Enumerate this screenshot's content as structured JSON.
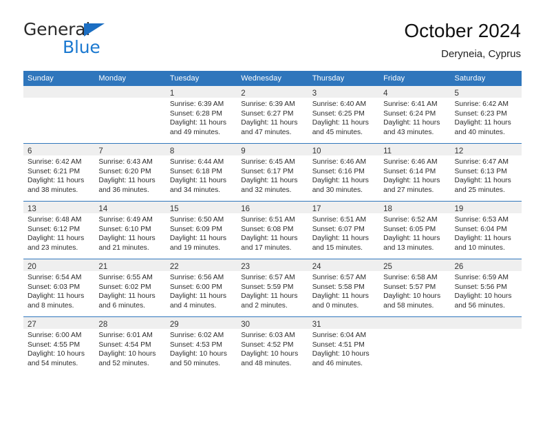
{
  "brand": {
    "word_one": "General",
    "word_two": "Blue",
    "triangle_icon": "triangle-logo-icon",
    "colors": {
      "dark": "#2b2b2b",
      "blue": "#1b79d0"
    }
  },
  "header": {
    "title": "October 2024",
    "subtitle": "Deryneia, Cyprus"
  },
  "theme": {
    "header_blue": "#2f76bc",
    "daynum_band": "#efefef",
    "text": "#2b2b2b"
  },
  "weekday_headers": [
    "Sunday",
    "Monday",
    "Tuesday",
    "Wednesday",
    "Thursday",
    "Friday",
    "Saturday"
  ],
  "labels": {
    "sunrise_prefix": "Sunrise:",
    "sunset_prefix": "Sunset:",
    "daylight_prefix": "Daylight:"
  },
  "weeks": [
    [
      {
        "day": "",
        "empty": true
      },
      {
        "day": "",
        "empty": true
      },
      {
        "day": "1",
        "line1": "Sunrise: 6:39 AM",
        "line2": "Sunset: 6:28 PM",
        "line3": "Daylight: 11 hours",
        "line4": "and 49 minutes."
      },
      {
        "day": "2",
        "line1": "Sunrise: 6:39 AM",
        "line2": "Sunset: 6:27 PM",
        "line3": "Daylight: 11 hours",
        "line4": "and 47 minutes."
      },
      {
        "day": "3",
        "line1": "Sunrise: 6:40 AM",
        "line2": "Sunset: 6:25 PM",
        "line3": "Daylight: 11 hours",
        "line4": "and 45 minutes."
      },
      {
        "day": "4",
        "line1": "Sunrise: 6:41 AM",
        "line2": "Sunset: 6:24 PM",
        "line3": "Daylight: 11 hours",
        "line4": "and 43 minutes."
      },
      {
        "day": "5",
        "line1": "Sunrise: 6:42 AM",
        "line2": "Sunset: 6:23 PM",
        "line3": "Daylight: 11 hours",
        "line4": "and 40 minutes."
      }
    ],
    [
      {
        "day": "6",
        "line1": "Sunrise: 6:42 AM",
        "line2": "Sunset: 6:21 PM",
        "line3": "Daylight: 11 hours",
        "line4": "and 38 minutes."
      },
      {
        "day": "7",
        "line1": "Sunrise: 6:43 AM",
        "line2": "Sunset: 6:20 PM",
        "line3": "Daylight: 11 hours",
        "line4": "and 36 minutes."
      },
      {
        "day": "8",
        "line1": "Sunrise: 6:44 AM",
        "line2": "Sunset: 6:18 PM",
        "line3": "Daylight: 11 hours",
        "line4": "and 34 minutes."
      },
      {
        "day": "9",
        "line1": "Sunrise: 6:45 AM",
        "line2": "Sunset: 6:17 PM",
        "line3": "Daylight: 11 hours",
        "line4": "and 32 minutes."
      },
      {
        "day": "10",
        "line1": "Sunrise: 6:46 AM",
        "line2": "Sunset: 6:16 PM",
        "line3": "Daylight: 11 hours",
        "line4": "and 30 minutes."
      },
      {
        "day": "11",
        "line1": "Sunrise: 6:46 AM",
        "line2": "Sunset: 6:14 PM",
        "line3": "Daylight: 11 hours",
        "line4": "and 27 minutes."
      },
      {
        "day": "12",
        "line1": "Sunrise: 6:47 AM",
        "line2": "Sunset: 6:13 PM",
        "line3": "Daylight: 11 hours",
        "line4": "and 25 minutes."
      }
    ],
    [
      {
        "day": "13",
        "line1": "Sunrise: 6:48 AM",
        "line2": "Sunset: 6:12 PM",
        "line3": "Daylight: 11 hours",
        "line4": "and 23 minutes."
      },
      {
        "day": "14",
        "line1": "Sunrise: 6:49 AM",
        "line2": "Sunset: 6:10 PM",
        "line3": "Daylight: 11 hours",
        "line4": "and 21 minutes."
      },
      {
        "day": "15",
        "line1": "Sunrise: 6:50 AM",
        "line2": "Sunset: 6:09 PM",
        "line3": "Daylight: 11 hours",
        "line4": "and 19 minutes."
      },
      {
        "day": "16",
        "line1": "Sunrise: 6:51 AM",
        "line2": "Sunset: 6:08 PM",
        "line3": "Daylight: 11 hours",
        "line4": "and 17 minutes."
      },
      {
        "day": "17",
        "line1": "Sunrise: 6:51 AM",
        "line2": "Sunset: 6:07 PM",
        "line3": "Daylight: 11 hours",
        "line4": "and 15 minutes."
      },
      {
        "day": "18",
        "line1": "Sunrise: 6:52 AM",
        "line2": "Sunset: 6:05 PM",
        "line3": "Daylight: 11 hours",
        "line4": "and 13 minutes."
      },
      {
        "day": "19",
        "line1": "Sunrise: 6:53 AM",
        "line2": "Sunset: 6:04 PM",
        "line3": "Daylight: 11 hours",
        "line4": "and 10 minutes."
      }
    ],
    [
      {
        "day": "20",
        "line1": "Sunrise: 6:54 AM",
        "line2": "Sunset: 6:03 PM",
        "line3": "Daylight: 11 hours",
        "line4": "and 8 minutes."
      },
      {
        "day": "21",
        "line1": "Sunrise: 6:55 AM",
        "line2": "Sunset: 6:02 PM",
        "line3": "Daylight: 11 hours",
        "line4": "and 6 minutes."
      },
      {
        "day": "22",
        "line1": "Sunrise: 6:56 AM",
        "line2": "Sunset: 6:00 PM",
        "line3": "Daylight: 11 hours",
        "line4": "and 4 minutes."
      },
      {
        "day": "23",
        "line1": "Sunrise: 6:57 AM",
        "line2": "Sunset: 5:59 PM",
        "line3": "Daylight: 11 hours",
        "line4": "and 2 minutes."
      },
      {
        "day": "24",
        "line1": "Sunrise: 6:57 AM",
        "line2": "Sunset: 5:58 PM",
        "line3": "Daylight: 11 hours",
        "line4": "and 0 minutes."
      },
      {
        "day": "25",
        "line1": "Sunrise: 6:58 AM",
        "line2": "Sunset: 5:57 PM",
        "line3": "Daylight: 10 hours",
        "line4": "and 58 minutes."
      },
      {
        "day": "26",
        "line1": "Sunrise: 6:59 AM",
        "line2": "Sunset: 5:56 PM",
        "line3": "Daylight: 10 hours",
        "line4": "and 56 minutes."
      }
    ],
    [
      {
        "day": "27",
        "line1": "Sunrise: 6:00 AM",
        "line2": "Sunset: 4:55 PM",
        "line3": "Daylight: 10 hours",
        "line4": "and 54 minutes."
      },
      {
        "day": "28",
        "line1": "Sunrise: 6:01 AM",
        "line2": "Sunset: 4:54 PM",
        "line3": "Daylight: 10 hours",
        "line4": "and 52 minutes."
      },
      {
        "day": "29",
        "line1": "Sunrise: 6:02 AM",
        "line2": "Sunset: 4:53 PM",
        "line3": "Daylight: 10 hours",
        "line4": "and 50 minutes."
      },
      {
        "day": "30",
        "line1": "Sunrise: 6:03 AM",
        "line2": "Sunset: 4:52 PM",
        "line3": "Daylight: 10 hours",
        "line4": "and 48 minutes."
      },
      {
        "day": "31",
        "line1": "Sunrise: 6:04 AM",
        "line2": "Sunset: 4:51 PM",
        "line3": "Daylight: 10 hours",
        "line4": "and 46 minutes."
      },
      {
        "day": "",
        "empty": true
      },
      {
        "day": "",
        "empty": true
      }
    ]
  ]
}
